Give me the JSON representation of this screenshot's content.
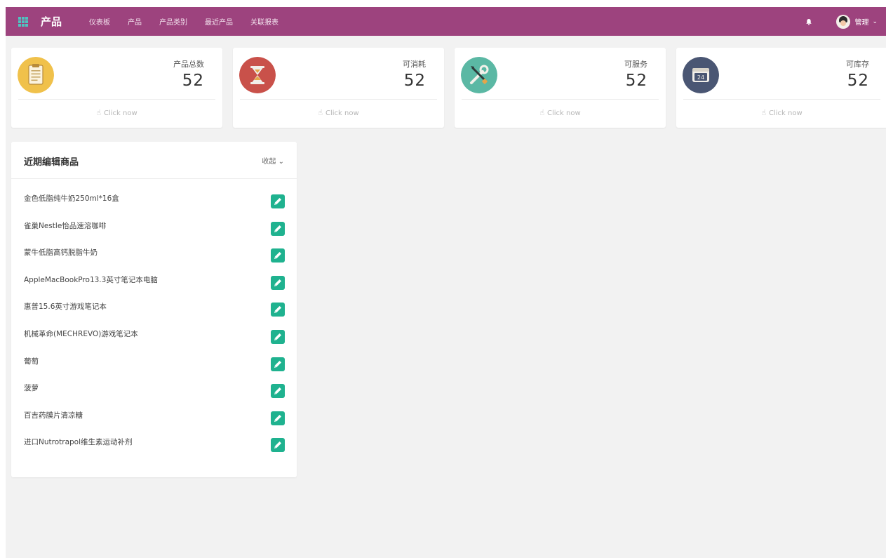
{
  "header": {
    "brand": "产品",
    "nav": [
      "仪表板",
      "产品",
      "产品类别",
      "最近产品",
      "关联报表"
    ],
    "user_name": "管理"
  },
  "cards": [
    {
      "label": "产品总数",
      "value": "52",
      "link_text": "Click now",
      "color": "#f0c14b",
      "icon": "clipboard-icon"
    },
    {
      "label": "可消耗",
      "value": "52",
      "link_text": "Click now",
      "color": "#c9514a",
      "icon": "hourglass-icon"
    },
    {
      "label": "可服务",
      "value": "52",
      "link_text": "Click now",
      "color": "#5bb8a4",
      "icon": "tools-icon"
    },
    {
      "label": "可库存",
      "value": "52",
      "link_text": "Click now",
      "color": "#4a5673",
      "icon": "inventory-icon"
    }
  ],
  "panel": {
    "title": "近期编辑商品",
    "toggle_label": "收起",
    "items": [
      "金色低脂纯牛奶250ml*16盒",
      "雀巢Nestle怡品速溶咖啡",
      "蒙牛低脂高钙脱脂牛奶",
      "AppleMacBookPro13.3英寸笔记本电脑",
      "惠普15.6英寸游戏笔记本",
      "机械革命(MECHREVO)游戏笔记本",
      "葡萄",
      "菠萝",
      "百吉药膜片清凉糖",
      "进口Nutrotrapol维生素运动补剂"
    ]
  }
}
